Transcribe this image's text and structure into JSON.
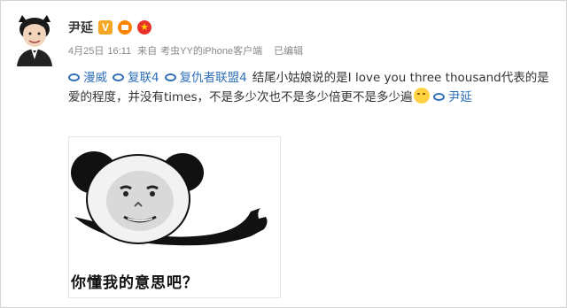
{
  "post": {
    "username": "尹延",
    "meta": {
      "date": "4月25日",
      "time": "16:11",
      "from_label": "来自",
      "source": "考虫YY的iPhone客户端",
      "edited": "已编辑"
    },
    "tags": [
      "漫威",
      "复联4",
      "复仇者联盟4"
    ],
    "text_part1": "结尾小姑娘说的是I love you three thousand代表的是爱的程度，并没有times，不是多少次也不是多少倍更不是多少遍",
    "mention": "尹延"
  },
  "meme": {
    "caption": "你懂我的意思吧？"
  },
  "colors": {
    "link": "#2f6fb7",
    "meta": "#888888",
    "text": "#333333",
    "v_badge": "#f5a623"
  },
  "icons": {
    "verified": "V-badge",
    "member": "crown-badge",
    "star": "star-badge",
    "link": "link-icon",
    "emoji": "laugh-cry-emoji"
  }
}
